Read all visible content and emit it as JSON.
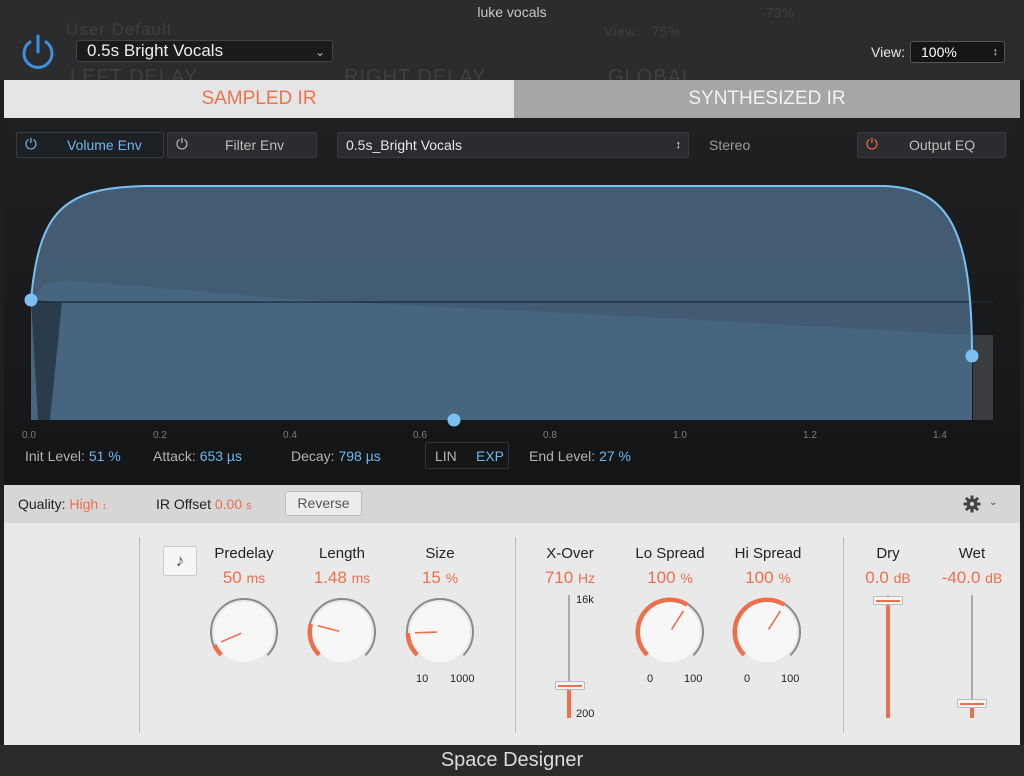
{
  "window": {
    "title": "luke vocals"
  },
  "header": {
    "preset": "0.5s Bright Vocals",
    "view_label": "View:",
    "view_value": "100%",
    "background_ghost": {
      "preset": "User Default",
      "view_label": "View:",
      "view_value": "75%",
      "zoom_value": "73%",
      "left_delay": "LEFT DELAY",
      "right_delay": "RIGHT DELAY",
      "global": "GLOBAL"
    }
  },
  "tabs": {
    "sampled": "SAMPLED IR",
    "synthesized": "SYNTHESIZED IR"
  },
  "env_toolbar": {
    "volume_env": "Volume Env",
    "filter_env": "Filter Env",
    "ir_file": "0.5s_Bright Vocals",
    "stereo": "Stereo",
    "output_eq": "Output EQ"
  },
  "axis_ticks": [
    "0.0",
    "0.2",
    "0.4",
    "0.6",
    "0.8",
    "1.0",
    "1.2",
    "1.4"
  ],
  "env_params": {
    "init_level_label": "Init Level:",
    "init_level_value": "51 %",
    "attack_label": "Attack:",
    "attack_value": "653 µs",
    "decay_label": "Decay:",
    "decay_value": "798 µs",
    "lin": "LIN",
    "exp": "EXP",
    "end_level_label": "End Level:",
    "end_level_value": "27 %"
  },
  "settings": {
    "quality_label": "Quality:",
    "quality_value": "High",
    "ir_offset_label": "IR Offset",
    "ir_offset_value": "0.00",
    "ir_offset_unit": "s",
    "reverse": "Reverse"
  },
  "knobs": {
    "predelay": {
      "label": "Predelay",
      "value": "50",
      "unit": "ms",
      "fraction": 0.08
    },
    "length": {
      "label": "Length",
      "value": "1.48",
      "unit": "ms",
      "fraction": 0.22
    },
    "size": {
      "label": "Size",
      "value": "15",
      "unit": "%",
      "fraction": 0.16,
      "min": "10",
      "max": "1000"
    },
    "lo_spread": {
      "label": "Lo Spread",
      "value": "100",
      "unit": "%",
      "fraction": 0.62,
      "min": "0",
      "max": "100"
    },
    "hi_spread": {
      "label": "Hi Spread",
      "value": "100",
      "unit": "%",
      "fraction": 0.62,
      "min": "0",
      "max": "100"
    }
  },
  "xover": {
    "label": "X-Over",
    "value": "710",
    "unit": "Hz",
    "max": "16k",
    "min": "200",
    "fraction": 0.27
  },
  "dry": {
    "label": "Dry",
    "value": "0.0",
    "unit": "dB",
    "fraction": 0.96
  },
  "wet": {
    "label": "Wet",
    "value": "-40.0",
    "unit": "dB",
    "fraction": 0.12
  },
  "footer": {
    "title": "Space Designer"
  },
  "colors": {
    "accent": "#ee6f4c",
    "blue": "#6fb8ee",
    "env_fill": "#4a6782"
  }
}
